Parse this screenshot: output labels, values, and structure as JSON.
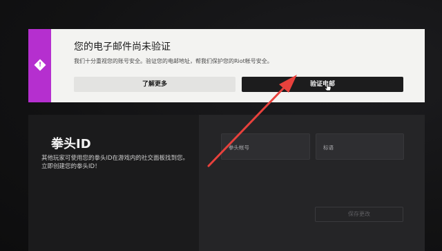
{
  "alert": {
    "icon": "warning-icon",
    "title": "您的电子邮件尚未验证",
    "description": "我们十分重视您的账号安全。验证您的电邮地址，帮我们保护您的Riot帐号安全。",
    "learn_more_label": "了解更多",
    "verify_label": "验证电邮",
    "accent_color": "#b52fcf"
  },
  "riot_id": {
    "title": "拳头ID",
    "description": "其他玩家可使用您的拳头ID在游戏内的社交面板找到您。立即创建您的拳头ID！",
    "fields": {
      "riot_account_label": "拳头帐号",
      "tagline_label": "标语"
    },
    "save_label": "保存更改"
  },
  "annotation": {
    "arrow_color": "#e8413c"
  }
}
